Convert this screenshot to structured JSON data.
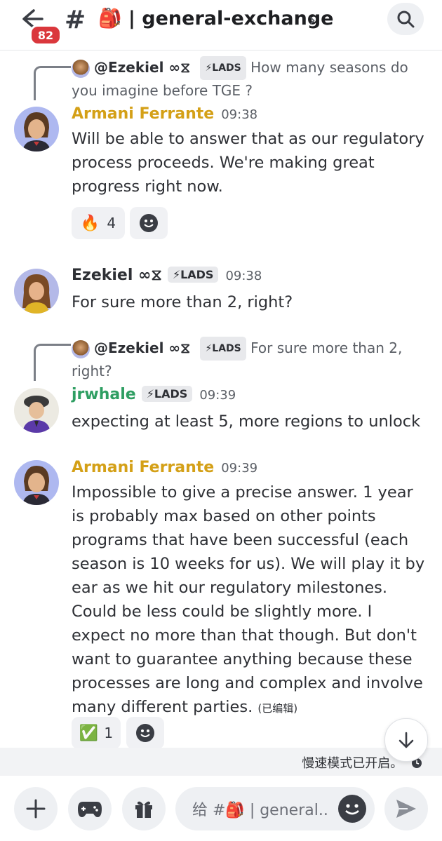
{
  "header": {
    "unread_count": "82",
    "channel_icon": "#",
    "channel_name": "🎒 | general-exchange",
    "chevron": "›"
  },
  "colors": {
    "armani": "#d4a017",
    "jrwhale": "#2e9e62",
    "badge": "#da373c"
  },
  "messages": [
    {
      "reply_user": "@Ezekiel ∞⧖",
      "reply_tag": "⚡LADS",
      "reply_text": "How many seasons do you imagine before TGE ?",
      "author": "Armani Ferrante",
      "time": "09:38",
      "text": "Will be able to answer that as our regulatory process proceeds. We're making great progress right now.",
      "reaction_emoji": "🔥",
      "reaction_count": "4"
    },
    {
      "author": "Ezekiel ∞⧖",
      "tag": "⚡LADS",
      "time": "09:38",
      "text": "For sure more than 2, right?"
    },
    {
      "reply_user": "@Ezekiel ∞⧖",
      "reply_tag": "⚡LADS",
      "reply_text": "For sure more than 2, right?",
      "author": "jrwhale",
      "tag": "⚡LADS",
      "time": "09:39",
      "text": "expecting at least 5, more regions to unlock"
    },
    {
      "author": "Armani Ferrante",
      "time": "09:39",
      "text": "Impossible to give a precise answer. 1 year is probably max based on other points programs that have been successful (each season is 10 weeks for us). We will play it by ear as we hit our regulatory milestones. Could be less could be slightly more. I expect no more than that though. But don't want to guarantee anything because these processes are long and complex and involve many different parties.",
      "edited": "(已编辑)",
      "reaction_emoji": "✅",
      "reaction_count": "1"
    }
  ],
  "slow_mode": "慢速模式已开启。",
  "composer": {
    "placeholder": "给 #🎒 | general.."
  }
}
